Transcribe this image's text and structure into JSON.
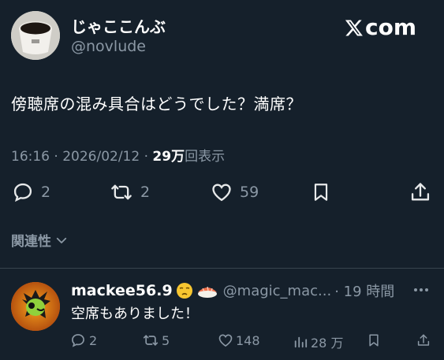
{
  "tweet": {
    "display_name": "じゃここんぶ",
    "handle": "@novlude",
    "site_logo": "com",
    "text": "傍聴席の混み具合はどうでした？満席？",
    "time": "16:16 · 2026/02/12 · ",
    "views_count": "29万",
    "views_label": "回表示",
    "actions": {
      "reply_count": "2",
      "retweet_count": "2",
      "like_count": "59"
    },
    "related_label": "関連性"
  },
  "reply": {
    "display_name": "mackee56.9",
    "handle": "@magic_mac...",
    "time": "· 19 時間",
    "text": "空席もありました！",
    "actions": {
      "reply_count": "2",
      "retweet_count": "5",
      "like_count": "148",
      "views_count": "28 万"
    }
  },
  "colors": {
    "background": "#15202b",
    "text": "#e7e9ea",
    "secondary": "#8b98a5",
    "divider": "#38444d"
  },
  "icons": [
    "reply-icon",
    "retweet-icon",
    "like-icon",
    "bookmark-icon",
    "share-icon",
    "chevron-down-icon",
    "more-icon",
    "views-icon",
    "x-logo-icon"
  ]
}
